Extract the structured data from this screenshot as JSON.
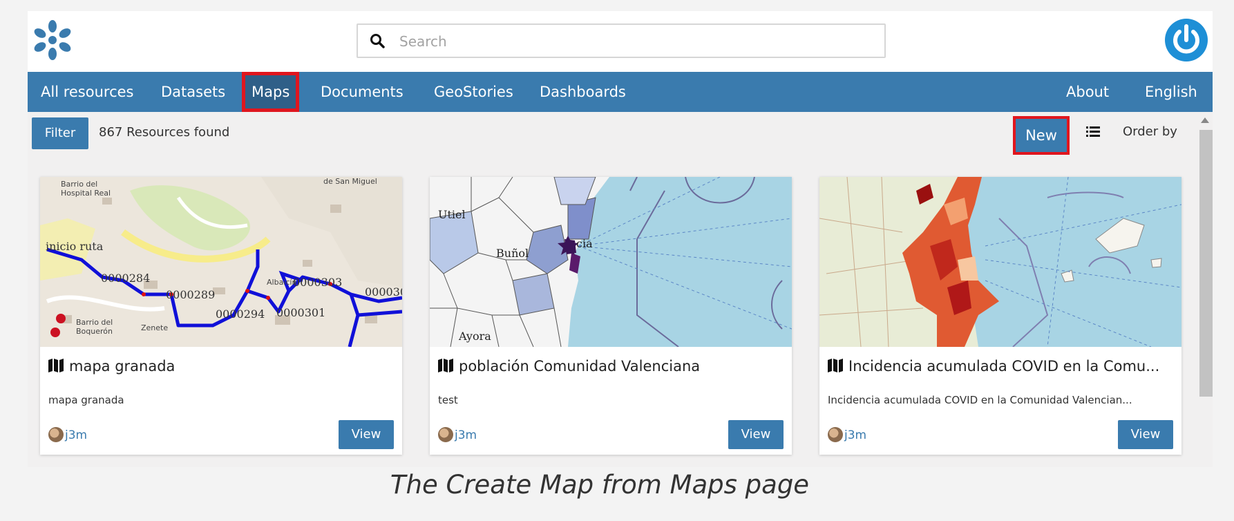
{
  "search": {
    "placeholder": "Search"
  },
  "nav": {
    "items": [
      "All resources",
      "Datasets",
      "Maps",
      "Documents",
      "GeoStories",
      "Dashboards"
    ],
    "right": [
      "About",
      "English"
    ],
    "active": "Maps"
  },
  "toolbar": {
    "filter_label": "Filter",
    "results": "867 Resources found",
    "new_label": "New",
    "order_label": "Order by"
  },
  "cards": [
    {
      "title": "mapa granada",
      "description": "mapa granada",
      "owner": "j3m",
      "view_label": "View"
    },
    {
      "title": "población Comunidad Valenciana",
      "description": "test",
      "owner": "j3m",
      "view_label": "View"
    },
    {
      "title": "Incidencia acumulada COVID en la Comu...",
      "description": "Incidencia acumulada COVID en la Comunidad Valencian...",
      "owner": "j3m",
      "view_label": "View"
    }
  ],
  "map_labels": {
    "granada": [
      "Barrio del",
      "Hospital Real",
      "de San Miguel",
      "inicio ruta",
      "0000284",
      "0000289",
      "0000294",
      "0000301",
      "0000303",
      "000030",
      "Barrio del",
      "Boquerón",
      "Zenete",
      "Albaicín"
    ],
    "valencia": [
      "Utiel",
      "Buñol",
      "Ayora",
      "cia"
    ]
  },
  "caption": "The Create Map from Maps page",
  "colors": {
    "accent": "#3a7bae",
    "highlight": "#e0161e",
    "nav_active": "#2f5f88"
  }
}
